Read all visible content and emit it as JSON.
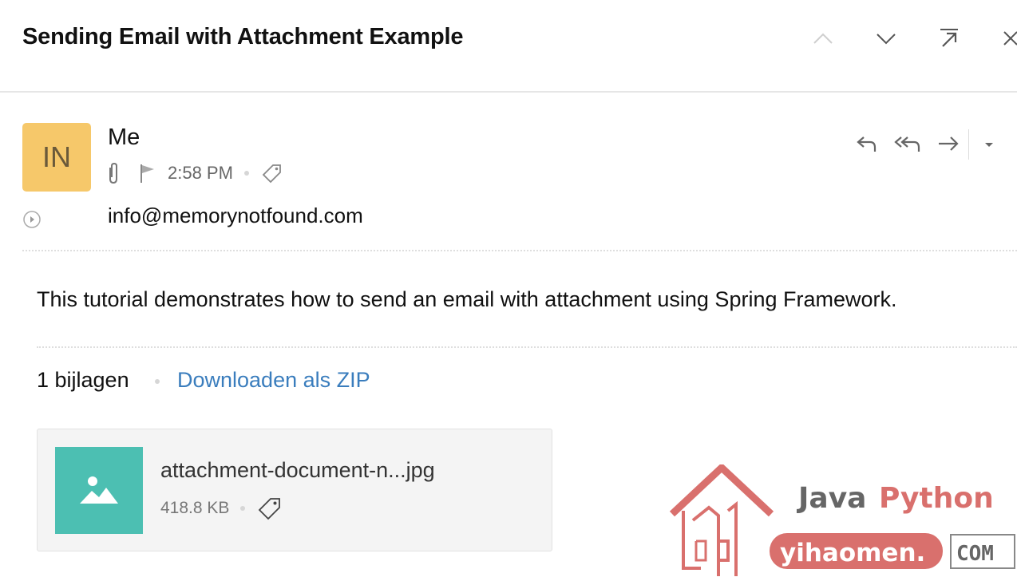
{
  "email": {
    "subject": "Sending Email with Attachment Example",
    "sender_initials": "IN",
    "sender_name": "Me",
    "time": "2:58 PM",
    "to": "info@memorynotfound.com",
    "body": "This tutorial demonstrates how to send an email with attachment using Spring Framework."
  },
  "attachments": {
    "count_label": "1 bijlagen",
    "download_zip": "Downloaden als ZIP",
    "items": [
      {
        "name": "attachment-document-n...jpg",
        "size": "418.8 KB"
      }
    ]
  },
  "watermark": {
    "word1": "Java",
    "word2": "Python",
    "site": "yihaomen.",
    "tld": "COM"
  },
  "icons": {
    "prev": "chevron-up-icon",
    "next": "chevron-down-icon",
    "popout": "popout-icon",
    "close": "close-icon",
    "reply": "reply-icon",
    "reply_all": "reply-all-icon",
    "forward": "forward-icon",
    "more": "caret-down-icon",
    "attachment": "paperclip-icon",
    "flag": "flag-icon",
    "tag": "tag-icon",
    "expand": "expand-details-icon",
    "image": "image-icon"
  },
  "colors": {
    "avatar_bg": "#f6c86a",
    "link": "#3a7dbd",
    "thumb_bg": "#4cbfb2",
    "watermark_red": "#d9706d"
  }
}
